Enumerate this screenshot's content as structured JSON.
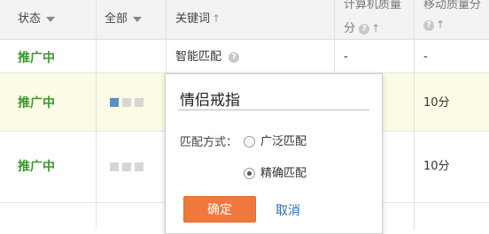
{
  "header": {
    "status_label": "状态",
    "all_label": "全部",
    "keyword_label": "关键词",
    "pc_quality_top": "计算机质量",
    "pc_quality_sub": "分",
    "mobile_quality_top": "移动质量分",
    "up_arrow": "↑",
    "question": "?"
  },
  "rows": [
    {
      "status": "推广中",
      "keyword": "智能匹配",
      "pc_quality": "-",
      "mobile_quality": "-"
    },
    {
      "status": "推广中",
      "mobile_quality": "10分"
    },
    {
      "status": "推广中",
      "mobile_quality": "10分"
    }
  ],
  "popup": {
    "keyword_value": "情侣戒指",
    "match_label": "匹配方式：",
    "option_broad": "广泛匹配",
    "option_exact": "精确匹配",
    "selected": "exact",
    "confirm_label": "确定",
    "cancel_label": "取消"
  },
  "colors": {
    "status_green": "#3a9a2a",
    "highlight_row": "#fbfbe6",
    "confirm_orange": "#f0783c",
    "link_blue": "#2a6ab8"
  },
  "icons": [
    "dropdown-triangle-icon",
    "sort-up-arrow-icon",
    "question-circle-icon",
    "quality-block-icon"
  ]
}
